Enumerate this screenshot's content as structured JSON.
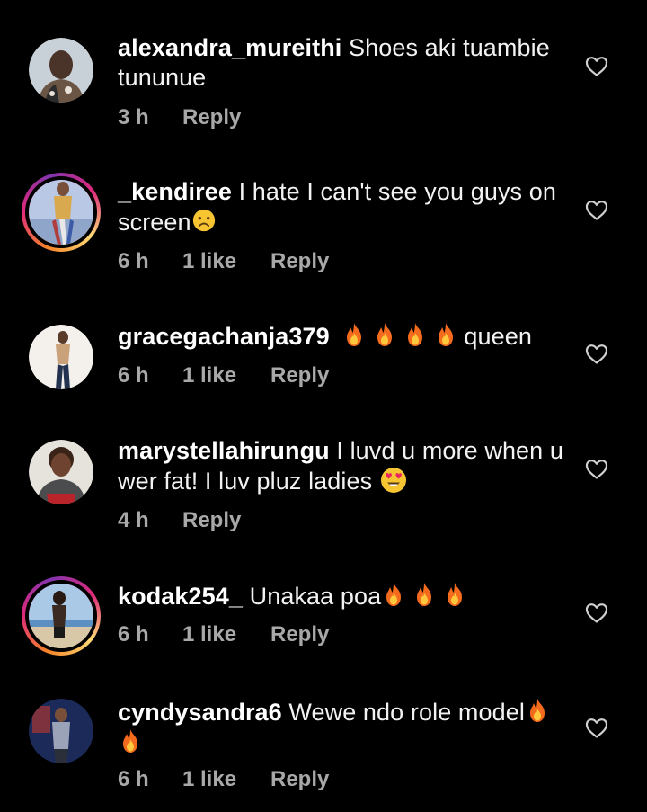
{
  "comments": [
    {
      "username": "alexandra_mureithi",
      "text": "Shoes aki tuambie tununue",
      "line1": "Shoes aki tuambie",
      "line2": "tununue",
      "time": "3 h",
      "likes": "",
      "reply": "Reply",
      "ring": false
    },
    {
      "username": "_kendiree",
      "text": "I hate I can't see you guys on screen",
      "line1": "I hate I can't see you guys on",
      "line2": "screen",
      "time": "6 h",
      "likes": "1 like",
      "reply": "Reply",
      "ring": true
    },
    {
      "username": "gracegachanja379",
      "text": "queen",
      "line1": "queen",
      "time": "6 h",
      "likes": "1 like",
      "reply": "Reply",
      "ring": false
    },
    {
      "username": "marystellahirungu",
      "text": "I luvd u more when u wer fat! I luv pluz ladies",
      "line1": "I luvd u more when u",
      "line2": "wer fat! I luv pluz ladies",
      "time": "4 h",
      "likes": "",
      "reply": "Reply",
      "ring": false
    },
    {
      "username": "kodak254_",
      "text": "Unakaa poa",
      "line1": "Unakaa poa",
      "time": "6 h",
      "likes": "1 like",
      "reply": "Reply",
      "ring": true
    },
    {
      "username": "cyndysandra6",
      "text": "Wewe ndo role model",
      "line1": "Wewe ndo role model",
      "time": "6 h",
      "likes": "1 like",
      "reply": "Reply",
      "ring": false
    }
  ],
  "icons": {
    "like": "heart-outline-icon",
    "fire": "fire-emoji",
    "sad": "frowning-face-emoji",
    "love": "heart-eyes-emoji"
  },
  "colors": {
    "background": "#000000",
    "primary_text": "#f5f5f5",
    "secondary_text": "#a8a8a8",
    "story_ring_start": "#f58529",
    "story_ring_end": "#dd2a7b"
  }
}
